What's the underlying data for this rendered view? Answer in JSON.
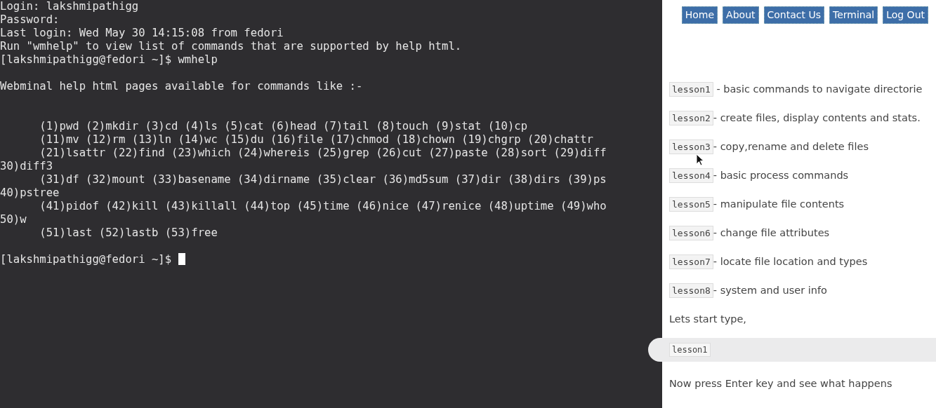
{
  "terminal": {
    "cursor": true,
    "lines": [
      {
        "kind": "text",
        "text": "Login: lakshmipathigg"
      },
      {
        "kind": "text",
        "text": "Password:"
      },
      {
        "kind": "text",
        "text": "Last login: Wed May 30 14:15:08 from fedori"
      },
      {
        "kind": "text",
        "text": "Run \"wmhelp\" to view list of commands that are supported by help html."
      },
      {
        "kind": "text",
        "text": "[lakshmipathigg@fedori ~]$ wmhelp"
      },
      {
        "kind": "blank"
      },
      {
        "kind": "text",
        "text": "Webminal help html pages available for commands like :-"
      },
      {
        "kind": "blank"
      },
      {
        "kind": "blank"
      },
      {
        "kind": "text",
        "text": "      (1)pwd (2)mkdir (3)cd (4)ls (5)cat (6)head (7)tail (8)touch (9)stat (10)cp"
      },
      {
        "kind": "text",
        "text": "      (11)mv (12)rm (13)ln (14)wc (15)du (16)file (17)chmod (18)chown (19)chgrp (20)chattr"
      },
      {
        "kind": "text",
        "text": "      (21)lsattr (22)find (23)which (24)whereis (25)grep (26)cut (27)paste (28)sort (29)diff"
      },
      {
        "kind": "text",
        "text": "30)diff3"
      },
      {
        "kind": "text",
        "text": "      (31)df (32)mount (33)basename (34)dirname (35)clear (36)md5sum (37)dir (38)dirs (39)ps"
      },
      {
        "kind": "text",
        "text": "40)pstree"
      },
      {
        "kind": "text",
        "text": "      (41)pidof (42)kill (43)killall (44)top (45)time (46)nice (47)renice (48)uptime (49)who"
      },
      {
        "kind": "text",
        "text": "50)w"
      },
      {
        "kind": "text",
        "text": "      (51)last (52)lastb (53)free"
      },
      {
        "kind": "blank"
      },
      {
        "kind": "prompt",
        "text": "[lakshmipathigg@fedori ~]$"
      }
    ]
  },
  "nav": [
    {
      "label": "Home"
    },
    {
      "label": "About"
    },
    {
      "label": "Contact Us"
    },
    {
      "label": "Terminal"
    },
    {
      "label": "Log Out"
    }
  ],
  "lessons": [
    {
      "code": "lesson1",
      "description": " - basic commands to navigate directorie"
    },
    {
      "code": "lesson2",
      "description": "- create files, display contents and stats."
    },
    {
      "code": "lesson3",
      "description": "- copy,rename and delete files"
    },
    {
      "code": "lesson4",
      "description": "- basic process commands"
    },
    {
      "code": "lesson5",
      "description": "- manipulate file contents"
    },
    {
      "code": "lesson6",
      "description": "- change file attributes"
    },
    {
      "code": "lesson7",
      "description": "- locate file location and types"
    },
    {
      "code": "lesson8",
      "description": "- system and user info"
    }
  ],
  "prompt_text": "Lets start type,",
  "input": {
    "value": "lesson1"
  },
  "instruction": "Now press Enter key and see what happens"
}
